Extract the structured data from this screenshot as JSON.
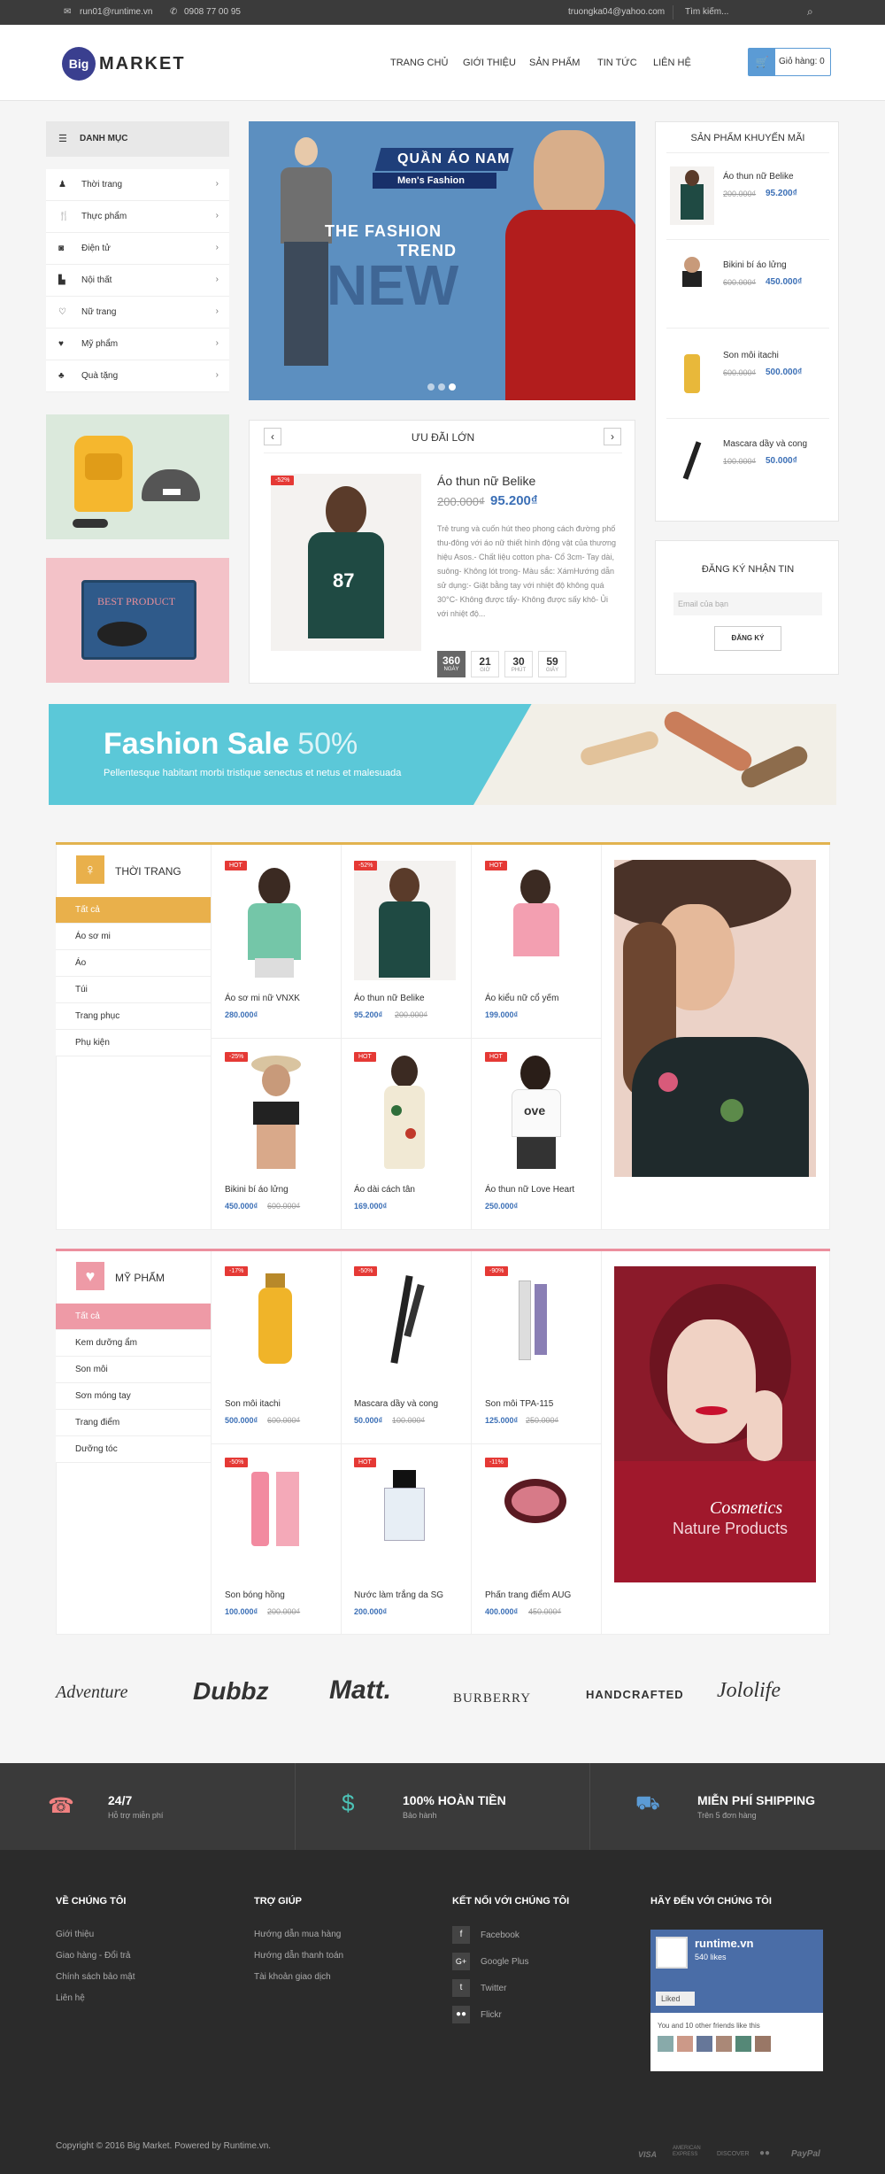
{
  "topbar": {
    "email": "run01@runtime.vn",
    "phone": "0908 77 00 95",
    "login": "truongka04@yahoo.com",
    "search_placeholder": "Tìm kiếm..."
  },
  "header": {
    "logo_badge": "Big",
    "logo_text": "MARKET",
    "nav": [
      "TRANG CHỦ",
      "GIỚI THIỆU",
      "SẢN PHẨM",
      "TIN TỨC",
      "LIÊN HỆ"
    ],
    "cart_label": "Giỏ hàng: 0"
  },
  "sidebar": {
    "title": "DANH MỤC",
    "items": [
      "Thời trang",
      "Thực phẩm",
      "Điện tử",
      "Nội thất",
      "Nữ trang",
      "Mỹ phẩm",
      "Quà tặng"
    ],
    "promo_text": "BEST PRODUCT"
  },
  "hero": {
    "tag1": "QUẦN ÁO NAM",
    "tag2": "Men's Fashion",
    "line1": "THE FASHION",
    "line2": "TREND",
    "line3": "NEW"
  },
  "deal": {
    "title": "ƯU ĐÃI LỚN",
    "badge": "-52%",
    "name": "Áo thun nữ Belike",
    "old_price": "200.000₫",
    "price": "95.200₫",
    "desc": "Trẻ trung và cuốn hút theo phong cách đường phố thu-đông với áo nữ thiết hình động vật của thương hiệu Asos.- Chất liệu cotton pha- Cổ 3cm- Tay dài, suông- Không lót trong- Màu sắc: XámHướng dẫn sử dụng:- Giặt bằng tay với nhiệt độ không quá 30°C- Không được tẩy- Không được sấy khô- Ủi với nhiệt độ...",
    "countdown": [
      {
        "v": "360",
        "l": "NGÀY"
      },
      {
        "v": "21",
        "l": "GIỜ"
      },
      {
        "v": "30",
        "l": "PHÚT"
      },
      {
        "v": "59",
        "l": "GIÂY"
      }
    ]
  },
  "promo": {
    "title": "SẢN PHẨM KHUYẾN MÃI",
    "items": [
      {
        "name": "Áo thun nữ Belike",
        "old": "200.000₫",
        "price": "95.200₫"
      },
      {
        "name": "Bikini bí áo lửng",
        "old": "600.000₫",
        "price": "450.000₫"
      },
      {
        "name": "Son môi itachi",
        "old": "600.000₫",
        "price": "500.000₫"
      },
      {
        "name": "Mascara dầy và cong",
        "old": "100.000₫",
        "price": "50.000₫"
      }
    ]
  },
  "newsletter": {
    "title": "ĐĂNG KÝ NHẬN TIN",
    "placeholder": "Email của bạn",
    "button": "ĐĂNG KÝ"
  },
  "banner": {
    "title": "Fashion Sale",
    "percent": "50%",
    "subtitle": "Pellentesque habitant morbi tristique senectus et netus et malesuada"
  },
  "fashion": {
    "title": "THỜI TRANG",
    "subs": [
      "Tất cả",
      "Áo sơ mi",
      "Áo",
      "Túi",
      "Trang phục",
      "Phụ kiện"
    ],
    "products": [
      {
        "badge": "HOT",
        "name": "Áo sơ mi nữ VNXK",
        "price": "280.000₫",
        "old": ""
      },
      {
        "badge": "-52%",
        "name": "Áo thun nữ Belike",
        "price": "95.200₫",
        "old": "200.000₫"
      },
      {
        "badge": "HOT",
        "name": "Áo kiểu nữ cổ yếm",
        "price": "199.000₫",
        "old": ""
      },
      {
        "badge": "-25%",
        "name": "Bikini bí áo lửng",
        "price": "450.000₫",
        "old": "600.000₫"
      },
      {
        "badge": "HOT",
        "name": "Áo dài cách tân",
        "price": "169.000₫",
        "old": ""
      },
      {
        "badge": "HOT",
        "name": "Áo thun nữ Love Heart",
        "price": "250.000₫",
        "old": ""
      }
    ]
  },
  "cosmetics": {
    "title": "MỸ PHẨM",
    "subs": [
      "Tất cả",
      "Kem dưỡng ẩm",
      "Son môi",
      "Sơn móng tay",
      "Trang điểm",
      "Dưỡng tóc"
    ],
    "products": [
      {
        "badge": "-17%",
        "name": "Son môi itachi",
        "price": "500.000₫",
        "old": "600.000₫"
      },
      {
        "badge": "-50%",
        "name": "Mascara dầy và cong",
        "price": "50.000₫",
        "old": "100.000₫"
      },
      {
        "badge": "-90%",
        "name": "Son môi TPA-115",
        "price": "125.000₫",
        "old": "250.000₫"
      },
      {
        "badge": "-50%",
        "name": "Son bóng hồng",
        "price": "100.000₫",
        "old": "200.000₫"
      },
      {
        "badge": "HOT",
        "name": "Nước làm trắng da SG",
        "price": "200.000₫",
        "old": ""
      },
      {
        "badge": "-11%",
        "name": "Phấn trang điểm AUG",
        "price": "400.000₫",
        "old": "450.000₫"
      }
    ],
    "caption1": "Cosmetics",
    "caption2": "Nature Products"
  },
  "brands": [
    "Adventure",
    "Dubbz",
    "Matt.",
    "BURBERRY",
    "HANDCRAFTED",
    "Jololife"
  ],
  "services": [
    {
      "title": "24/7",
      "sub": "Hỗ trợ miễn phí"
    },
    {
      "title": "100% HOÀN TIỀN",
      "sub": "Bảo hành"
    },
    {
      "title": "MIỄN PHÍ SHIPPING",
      "sub": "Trên 5 đơn hàng"
    }
  ],
  "footer": {
    "about_title": "VỀ CHÚNG TÔI",
    "about": [
      "Giới thiệu",
      "Giao hàng - Đổi trả",
      "Chính sách bảo mật",
      "Liên hệ"
    ],
    "help_title": "TRỢ GIÚP",
    "help": [
      "Hướng dẫn mua hàng",
      "Hướng dẫn thanh toán",
      "Tài khoản giao dịch"
    ],
    "social_title": "KẾT NỐI VỚI CHÚNG TÔI",
    "social": [
      "Facebook",
      "Google Plus",
      "Twitter",
      "Flickr"
    ],
    "visit_title": "HÃY ĐẾN VỚI CHÚNG TÔI",
    "fb_name": "runtime.vn",
    "fb_likes": "540 likes",
    "fb_liked": "Liked",
    "fb_friends": "You and 10 other friends like this",
    "copyright": "Copyright © 2016 Big Market. Powered by Runtime.vn.",
    "payments": [
      "VISA",
      "AMERICAN EXPRESS",
      "DISCOVER",
      "●●",
      "PayPal"
    ]
  }
}
